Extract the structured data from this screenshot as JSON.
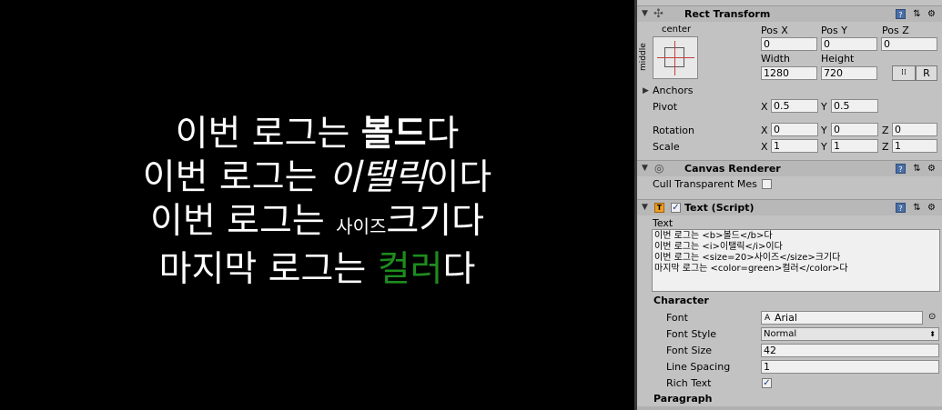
{
  "game_text": {
    "line1": {
      "prefix": "이번 로그는 ",
      "bold": "볼드",
      "suffix": "다"
    },
    "line2": {
      "prefix": "이번 로그는 ",
      "italic": "이탤릭",
      "suffix": "이다"
    },
    "line3": {
      "prefix": "이번 로그는 ",
      "small": "사이즈",
      "suffix": "크기다"
    },
    "line4": {
      "prefix": "마지막 로그는 ",
      "green": "컬러",
      "suffix": "다",
      "green_color": "#1e8c1e"
    }
  },
  "rect_transform": {
    "title": "Rect Transform",
    "anchor_preset_top": "center",
    "anchor_preset_side": "middle",
    "pos_x_label": "Pos X",
    "pos_y_label": "Pos Y",
    "pos_z_label": "Pos Z",
    "pos_x": "0",
    "pos_y": "0",
    "pos_z": "0",
    "width_label": "Width",
    "height_label": "Height",
    "width": "1280",
    "height": "720",
    "blueprint_button": "⁞⁞",
    "raw_button": "R",
    "anchors_label": "Anchors",
    "pivot_label": "Pivot",
    "pivot_x": "0.5",
    "pivot_y": "0.5",
    "rotation_label": "Rotation",
    "rot_x": "0",
    "rot_y": "0",
    "rot_z": "0",
    "scale_label": "Scale",
    "scale_x": "1",
    "scale_y": "1",
    "scale_z": "1",
    "x_label": "X",
    "y_label": "Y",
    "z_label": "Z"
  },
  "canvas_renderer": {
    "title": "Canvas Renderer",
    "cull_label": "Cull Transparent Mes"
  },
  "text_script": {
    "title": "Text (Script)",
    "text_label": "Text",
    "text_lines": [
      "이번 로그는 <b>볼드</b>다",
      "이번 로그는 <i>이탤릭</i>이다",
      "이번 로그는 <size=20>사이즈</size>크기다",
      "마지막 로그는 <color=green>컬러</color>다"
    ],
    "character_label": "Character",
    "font_label": "Font",
    "font_value": "Arial",
    "font_style_label": "Font Style",
    "font_style_value": "Normal",
    "font_size_label": "Font Size",
    "font_size_value": "42",
    "line_spacing_label": "Line Spacing",
    "line_spacing_value": "1",
    "rich_text_label": "Rich Text",
    "paragraph_label": "Paragraph"
  }
}
